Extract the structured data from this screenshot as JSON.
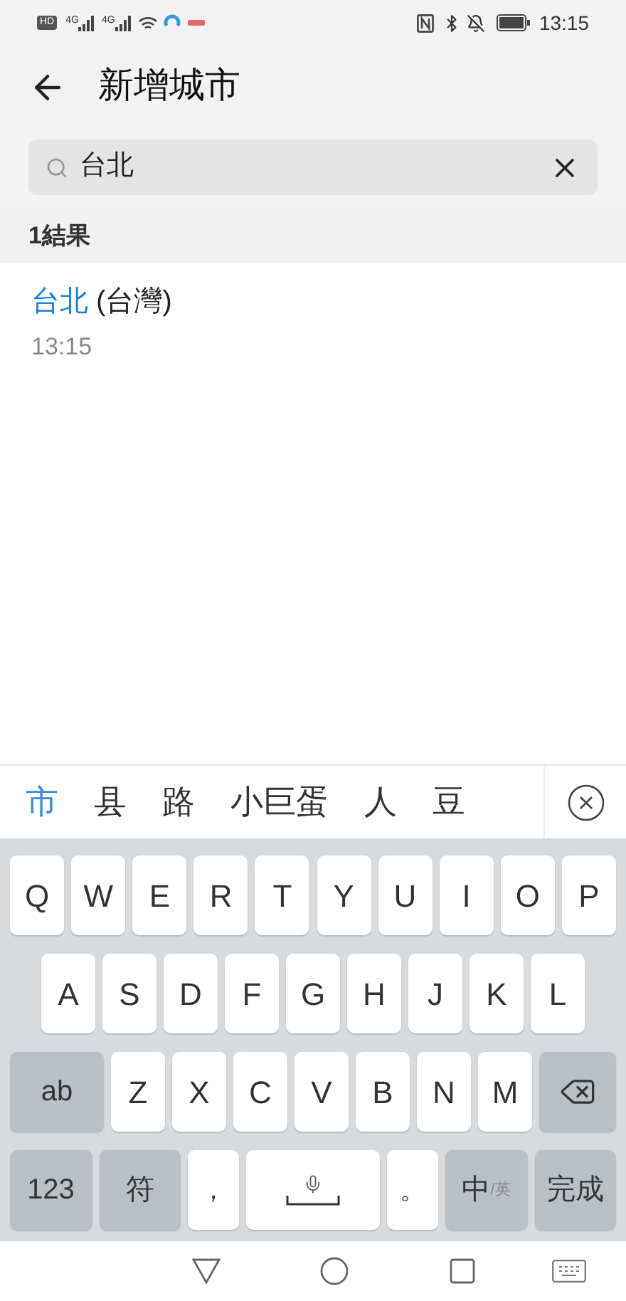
{
  "status_bar": {
    "hd": "HD",
    "networks": [
      "4G",
      "4G"
    ],
    "time": "13:15"
  },
  "header": {
    "title": "新增城市"
  },
  "search": {
    "value": "台北"
  },
  "results": {
    "count": "1結果",
    "items": [
      {
        "match": "台北",
        "rest": " (台灣)",
        "time": "13:15"
      }
    ]
  },
  "candidates": [
    {
      "text": "市",
      "selected": true
    },
    {
      "text": "县",
      "selected": false
    },
    {
      "text": "路",
      "selected": false
    },
    {
      "text": "小巨蛋",
      "selected": false
    },
    {
      "text": "人",
      "selected": false
    },
    {
      "text": "豆",
      "selected": false
    }
  ],
  "keyboard": {
    "rows": [
      {
        "keys": [
          {
            "kind": "letter",
            "label": "Q"
          },
          {
            "kind": "letter",
            "label": "W"
          },
          {
            "kind": "letter",
            "label": "E"
          },
          {
            "kind": "letter",
            "label": "R"
          },
          {
            "kind": "letter",
            "label": "T"
          },
          {
            "kind": "letter",
            "label": "Y"
          },
          {
            "kind": "letter",
            "label": "U"
          },
          {
            "kind": "letter",
            "label": "I"
          },
          {
            "kind": "letter",
            "label": "O"
          },
          {
            "kind": "letter",
            "label": "P"
          }
        ]
      },
      {
        "keys": [
          {
            "kind": "letter",
            "label": "A"
          },
          {
            "kind": "letter",
            "label": "S"
          },
          {
            "kind": "letter",
            "label": "D"
          },
          {
            "kind": "letter",
            "label": "F"
          },
          {
            "kind": "letter",
            "label": "G"
          },
          {
            "kind": "letter",
            "label": "H"
          },
          {
            "kind": "letter",
            "label": "J"
          },
          {
            "kind": "letter",
            "label": "K"
          },
          {
            "kind": "letter",
            "label": "L"
          }
        ]
      },
      {
        "keys": [
          {
            "kind": "function",
            "label": "ab"
          },
          {
            "kind": "letter",
            "label": "Z"
          },
          {
            "kind": "letter",
            "label": "X"
          },
          {
            "kind": "letter",
            "label": "C"
          },
          {
            "kind": "letter",
            "label": "V"
          },
          {
            "kind": "letter",
            "label": "B"
          },
          {
            "kind": "letter",
            "label": "N"
          },
          {
            "kind": "letter",
            "label": "M"
          },
          {
            "kind": "backspace"
          }
        ]
      },
      {
        "keys": [
          {
            "kind": "function",
            "label": "123"
          },
          {
            "kind": "function",
            "label": "符"
          },
          {
            "kind": "punct",
            "label": "，"
          },
          {
            "kind": "space"
          },
          {
            "kind": "punct",
            "label": "。"
          },
          {
            "kind": "lang",
            "label": "中",
            "sub": "/英"
          },
          {
            "kind": "function",
            "label": "完成"
          }
        ]
      }
    ]
  }
}
